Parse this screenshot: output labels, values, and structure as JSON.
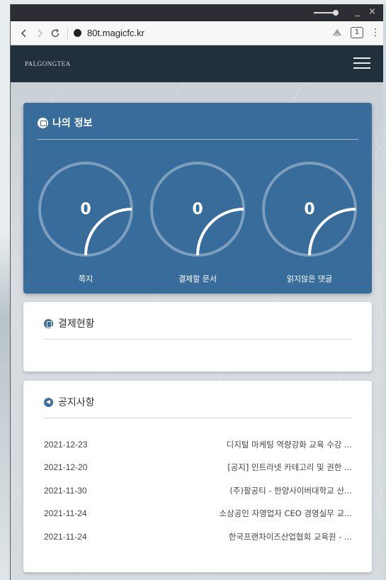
{
  "browser": {
    "url": "80t.magicfc.kr",
    "tab_count": "1",
    "minimize": "_",
    "close": "×",
    "menu_dots": "⋮"
  },
  "site": {
    "logo": "PALGONGTEA"
  },
  "my_info": {
    "title": "나의 정보",
    "stats": [
      {
        "label": "쪽지",
        "value": "0"
      },
      {
        "label": "결제할 문서",
        "value": "0"
      },
      {
        "label": "읽지않은 댓글",
        "value": "0"
      }
    ]
  },
  "approval": {
    "title": "결제현황"
  },
  "notices": {
    "title": "공지사항",
    "items": [
      {
        "date": "2021-12-23",
        "title": "디지털 마케팅 역량강화 교육 수강 ..."
      },
      {
        "date": "2021-12-20",
        "title": "[공지] 인트라넷 카테고리 및 권한 ..."
      },
      {
        "date": "2021-11-30",
        "title": "(주)팔공티 - 한양사이버대학교 산..."
      },
      {
        "date": "2021-11-24",
        "title": "소상공인 자영업자 CEO 경영실무 교..."
      },
      {
        "date": "2021-11-24",
        "title": "한국프랜차이즈산업협회 교육원 - ..."
      }
    ]
  },
  "colors": {
    "header_bg": "#22303c",
    "card_blue": "#386c9b",
    "icon_blue": "#3d6e9c"
  }
}
